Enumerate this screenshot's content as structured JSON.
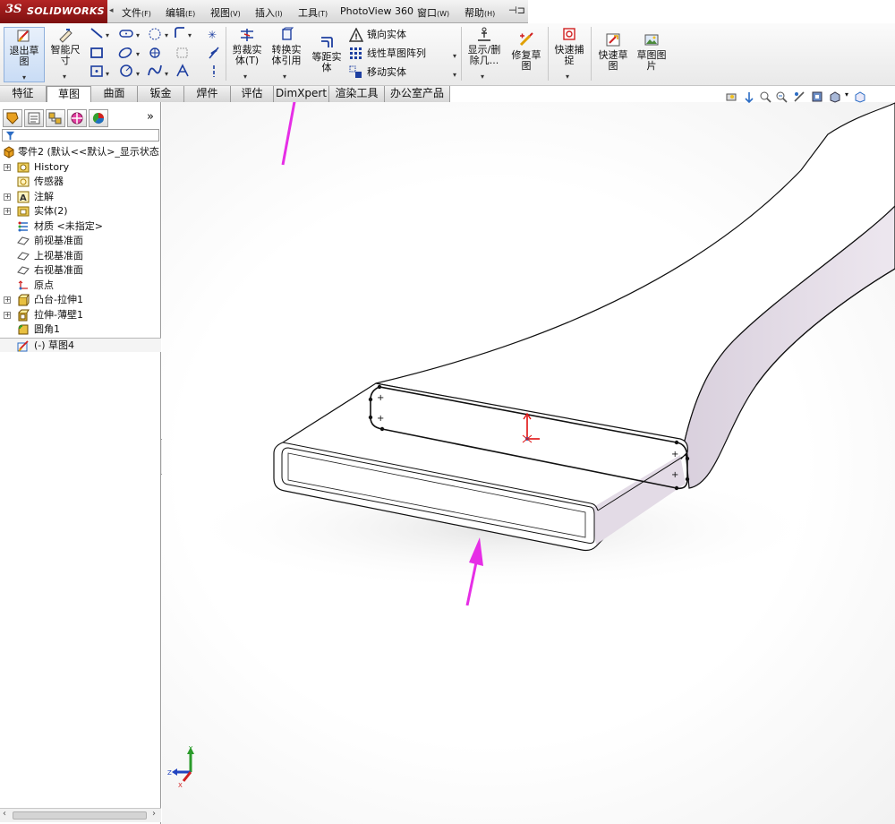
{
  "app": {
    "logo_ds": "3S",
    "logo_name": "SOLIDWORKS"
  },
  "menu": [
    {
      "label": "文件",
      "key": "(F)"
    },
    {
      "label": "编辑",
      "key": "(E)"
    },
    {
      "label": "视图",
      "key": "(V)"
    },
    {
      "label": "插入",
      "key": "(I)"
    },
    {
      "label": "工具",
      "key": "(T)"
    },
    {
      "label": "PhotoView 360",
      "key": ""
    },
    {
      "label": "窗口",
      "key": "(W)"
    },
    {
      "label": "帮助",
      "key": "(H)"
    }
  ],
  "toolbar": {
    "exit_sketch": "退出草\n图",
    "smart_dimension": "智能尺\n寸",
    "trim_entities": "剪裁实\n体(T)",
    "convert_entities": "转换实\n体引用",
    "offset_entities": "等距实\n体",
    "mirror_entities": "镜向实体",
    "linear_pattern": "线性草图阵列",
    "move_entities": "移动实体",
    "display_delete": "显示/删\n除几...",
    "repair_sketch": "修复草\n图",
    "quick_snaps": "快速捕\n捉",
    "rapid_sketch": "快速草\n图",
    "sketch_picture": "草图图\n片"
  },
  "tabs": [
    "特征",
    "草图",
    "曲面",
    "钣金",
    "焊件",
    "评估",
    "DimXpert",
    "渲染工具",
    "办公室产品"
  ],
  "active_tab": "草图",
  "tree": {
    "root": "零件2  (默认<<默认>_显示状态",
    "items": [
      {
        "label": "History",
        "expandable": true
      },
      {
        "label": "传感器",
        "expandable": false
      },
      {
        "label": "注解",
        "expandable": true
      },
      {
        "label": "实体(2)",
        "expandable": true
      },
      {
        "label": "材质 <未指定>",
        "expandable": false
      },
      {
        "label": "前视基准面",
        "expandable": false
      },
      {
        "label": "上视基准面",
        "expandable": false
      },
      {
        "label": "右视基准面",
        "expandable": false
      },
      {
        "label": "原点",
        "expandable": false
      },
      {
        "label": "凸台-拉伸1",
        "expandable": true
      },
      {
        "label": "拉伸-薄壁1",
        "expandable": true
      },
      {
        "label": "圆角1",
        "expandable": false
      },
      {
        "label": "(-) 草图4",
        "expandable": false
      }
    ]
  },
  "triad": {
    "x": "X",
    "y": "Y",
    "z": "Z"
  },
  "colors": {
    "accent_arrow": "#e62ee6",
    "brand_red": "#9b1a1a",
    "sketch_red": "#e01010",
    "model_face": "#e6dfe8"
  }
}
